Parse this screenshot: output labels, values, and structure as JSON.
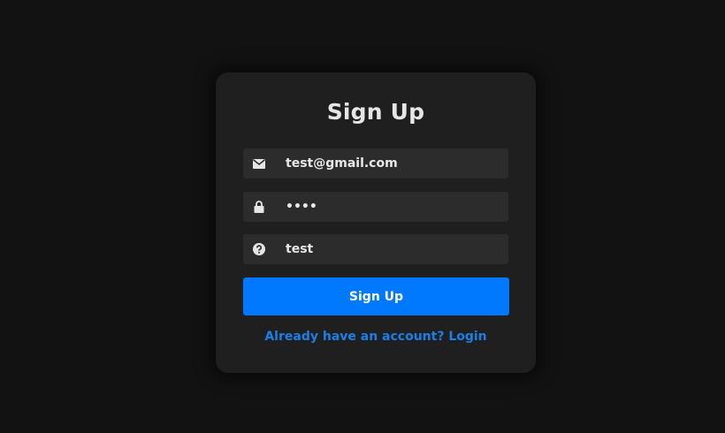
{
  "form": {
    "title": "Sign Up",
    "email": {
      "value": "test@gmail.com",
      "icon": "envelope-icon"
    },
    "password": {
      "value": "••••",
      "icon": "lock-icon"
    },
    "question": {
      "value": "test",
      "icon": "question-circle-icon"
    },
    "submit_label": "Sign Up",
    "login_link": "Already have an account? Login"
  },
  "colors": {
    "background": "#121212",
    "card": "#1f1f1f",
    "field": "#2c2c2c",
    "accent": "#0079ff",
    "link": "#1b7fe8"
  }
}
